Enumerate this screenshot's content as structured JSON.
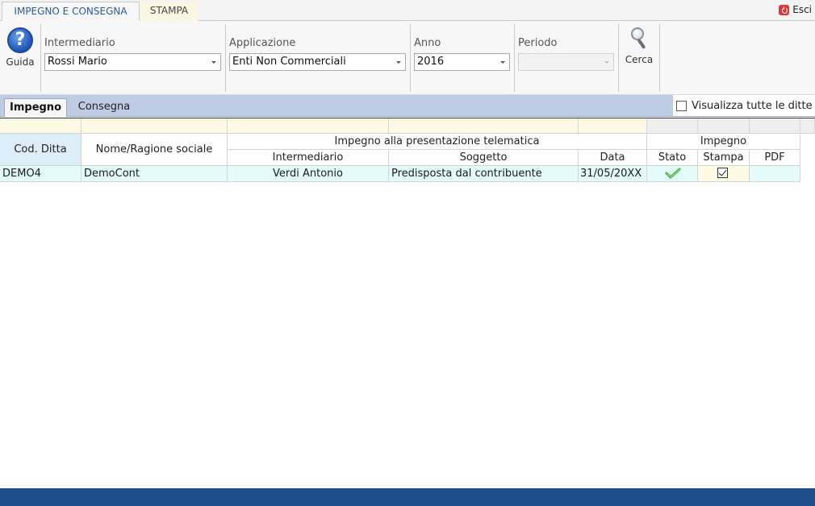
{
  "ribbon": {
    "tabs": [
      {
        "label": "IMPEGNO E CONSEGNA",
        "active": true
      },
      {
        "label": "STAMPA",
        "active": false
      }
    ],
    "exit_label": "Esci"
  },
  "toolbar": {
    "guida_label": "Guida",
    "cerca_label": "Cerca",
    "intermediario": {
      "label": "Intermediario",
      "value": "Rossi Mario"
    },
    "applicazione": {
      "label": "Applicazione",
      "value": "Enti Non Commerciali"
    },
    "anno": {
      "label": "Anno",
      "value": "2016"
    },
    "periodo": {
      "label": "Periodo",
      "value": ""
    }
  },
  "subtabs": [
    {
      "label": "Impegno",
      "active": true
    },
    {
      "label": "Consegna",
      "active": false
    }
  ],
  "show_all_label": "Visualizza tutte le ditte",
  "grid": {
    "headers": {
      "cod_ditta": "Cod. Ditta",
      "nome": "Nome/Ragione sociale",
      "group_telematica": "Impegno alla presentazione telematica",
      "intermediario": "Intermediario",
      "soggetto": "Soggetto",
      "data": "Data",
      "group_impegno": "Impegno",
      "stato": "Stato",
      "stampa": "Stampa",
      "pdf": "PDF"
    },
    "rows": [
      {
        "cod_ditta": "DEMO4",
        "nome": "DemoCont",
        "intermediario": "Verdi Antonio",
        "soggetto": "Predisposta dal contribuente",
        "data": "31/05/20XX",
        "stato": "check-icon",
        "stampa_checked": true,
        "pdf": ""
      }
    ]
  },
  "colors": {
    "accent_blue": "#2a5a9a",
    "subtab_strip": "#bfcbe2",
    "row_highlight": "#e3fbfb",
    "filter_row": "#fefbe4",
    "bottom_bar": "#1d4f8d"
  }
}
